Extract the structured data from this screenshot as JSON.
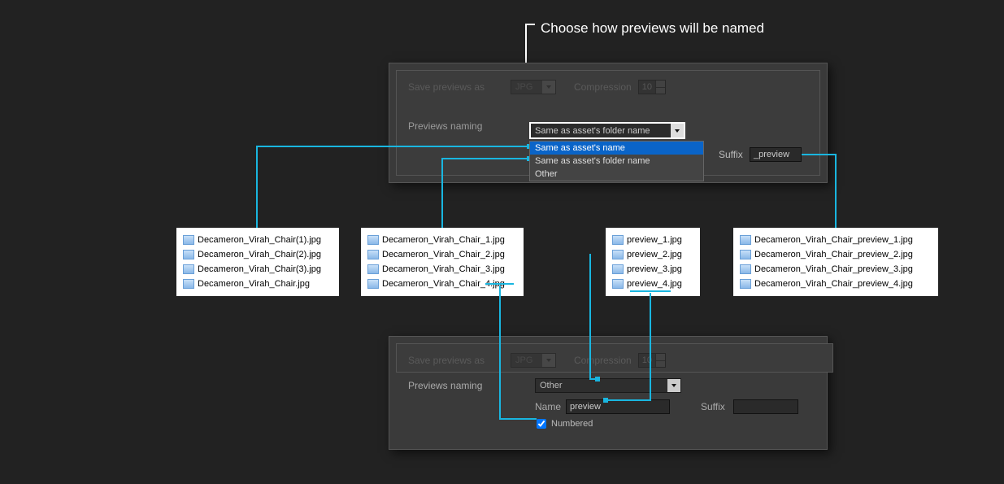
{
  "callout": {
    "text": "Choose how previews will be named"
  },
  "panel_top": {
    "save_label": "Save previews as",
    "format": "JPG",
    "compression_label": "Compression",
    "compression_value": "10",
    "naming_label": "Previews naming",
    "dropdown_selected": "Same as asset's folder name",
    "dropdown_options": [
      "Same as asset's name",
      "Same as asset's folder name",
      "Other"
    ],
    "suffix_label": "Suffix",
    "suffix_value": "_preview"
  },
  "panel_bottom": {
    "save_label": "Save previews as",
    "format": "JPG",
    "compression_label": "Compression",
    "compression_value": "10",
    "naming_label": "Previews naming",
    "dropdown_selected": "Other",
    "name_label": "Name",
    "name_value": "preview",
    "suffix_label": "Suffix",
    "suffix_value": "",
    "numbered_label": "Numbered",
    "numbered_checked": true
  },
  "files": {
    "box1": [
      "Decameron_Virah_Chair(1).jpg",
      "Decameron_Virah_Chair(2).jpg",
      "Decameron_Virah_Chair(3).jpg",
      "Decameron_Virah_Chair.jpg"
    ],
    "box2": [
      "Decameron_Virah_Chair_1.jpg",
      "Decameron_Virah_Chair_2.jpg",
      "Decameron_Virah_Chair_3.jpg",
      "Decameron_Virah_Chair_4.jpg"
    ],
    "box3": [
      "preview_1.jpg",
      "preview_2.jpg",
      "preview_3.jpg",
      "preview_4.jpg"
    ],
    "box4": [
      "Decameron_Virah_Chair_preview_1.jpg",
      "Decameron_Virah_Chair_preview_2.jpg",
      "Decameron_Virah_Chair_preview_3.jpg",
      "Decameron_Virah_Chair_preview_4.jpg"
    ]
  }
}
